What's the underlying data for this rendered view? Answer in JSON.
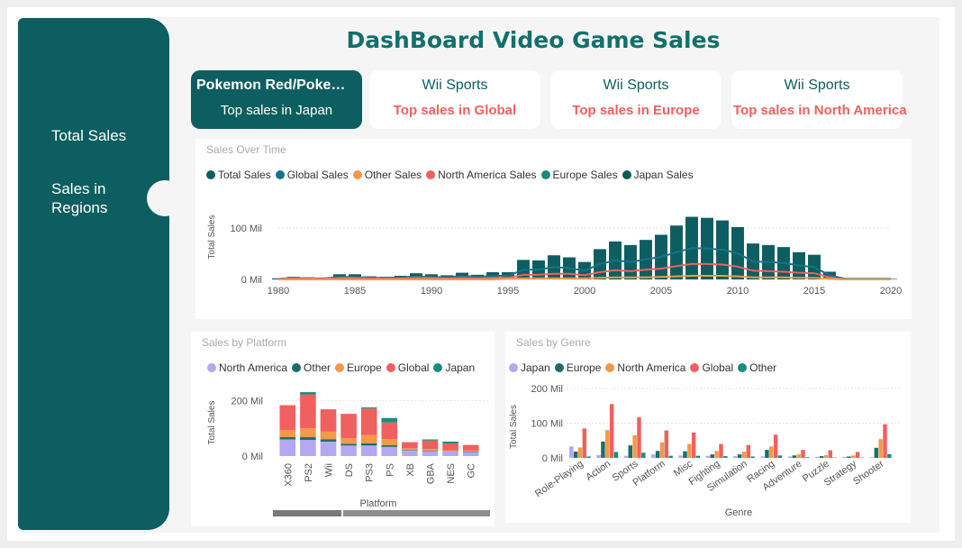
{
  "header": {
    "title": "DashBoard Video Game Sales"
  },
  "sidebar": {
    "items": [
      {
        "label": "Total Sales"
      },
      {
        "label": "Sales in Regions"
      }
    ]
  },
  "cards": [
    {
      "game": "Pokemon Red/Pokemon Blue",
      "caption": "Top sales in Japan",
      "active": true
    },
    {
      "game": "Wii Sports",
      "caption": "Top sales in Global",
      "active": false
    },
    {
      "game": "Wii Sports",
      "caption": "Top sales in Europe",
      "active": false
    },
    {
      "game": "Wii Sports",
      "caption": "Top sales in North America",
      "active": false
    }
  ],
  "colors": {
    "teal_dark": "#0d5e60",
    "teal": "#118dff",
    "other": "#f2994a",
    "north_america": "#f0605e",
    "europe": "#1a8c7e",
    "japan": "#0b5c50",
    "lavender": "#b3a8f2"
  },
  "chart_data": [
    {
      "type": "bar",
      "title": "Sales Over Time",
      "xlabel": "",
      "ylabel": "Total Sales",
      "yticks": [
        "0 Mil",
        "100 Mil"
      ],
      "xticks": [
        "1980",
        "1985",
        "1990",
        "1995",
        "2000",
        "2005",
        "2010",
        "2015",
        "2020"
      ],
      "xlim": [
        1980,
        2020
      ],
      "ylim": [
        0,
        130
      ],
      "legend": [
        "Total Sales",
        "Global Sales",
        "Other Sales",
        "North America  Sales",
        "Europe Sales",
        "Japan Sales"
      ],
      "legend_colors": [
        "#0d5e60",
        "#13748a",
        "#f2994a",
        "#f0605e",
        "#1a8c7e",
        "#0b5c50"
      ],
      "x": [
        1980,
        1981,
        1982,
        1983,
        1984,
        1985,
        1986,
        1987,
        1988,
        1989,
        1990,
        1991,
        1992,
        1993,
        1994,
        1995,
        1996,
        1997,
        1998,
        1999,
        2000,
        2001,
        2002,
        2003,
        2004,
        2005,
        2006,
        2007,
        2008,
        2009,
        2010,
        2011,
        2012,
        2013,
        2014,
        2015,
        2016,
        2017,
        2020
      ],
      "values": [
        2,
        5,
        4,
        3,
        10,
        10,
        6,
        5,
        7,
        12,
        10,
        8,
        13,
        9,
        14,
        14,
        38,
        37,
        47,
        43,
        34,
        59,
        74,
        67,
        77,
        87,
        105,
        122,
        120,
        115,
        102,
        70,
        67,
        63,
        53,
        48,
        15,
        1,
        1
      ],
      "lines": [
        {
          "name": "Global Sales",
          "color": "#13748a",
          "values": [
            1,
            3,
            2,
            2,
            5,
            5,
            3,
            3,
            4,
            6,
            5,
            4,
            7,
            5,
            7,
            7,
            19,
            19,
            24,
            22,
            17,
            30,
            37,
            34,
            39,
            44,
            53,
            61,
            60,
            58,
            51,
            35,
            34,
            32,
            27,
            24,
            8,
            1,
            1
          ]
        },
        {
          "name": "North America  Sales",
          "color": "#f0605e",
          "values": [
            1,
            2,
            2,
            1,
            3,
            3,
            2,
            2,
            2,
            3,
            3,
            2,
            3,
            2,
            3,
            3,
            9,
            9,
            11,
            11,
            8,
            14,
            18,
            16,
            19,
            21,
            26,
            30,
            30,
            29,
            25,
            17,
            16,
            15,
            13,
            12,
            4,
            0,
            0
          ]
        },
        {
          "name": "Other Sales",
          "color": "#f2994a",
          "values": [
            0,
            0,
            0,
            0,
            0,
            0,
            0,
            0,
            0,
            0,
            0,
            0,
            0,
            0,
            0,
            1,
            2,
            2,
            2,
            2,
            2,
            3,
            4,
            4,
            4,
            5,
            6,
            7,
            7,
            7,
            6,
            4,
            4,
            4,
            3,
            3,
            1,
            0,
            0
          ]
        }
      ]
    },
    {
      "type": "bar",
      "stacked": true,
      "title": "Sales by Platform",
      "xlabel": "Platform",
      "ylabel": "Total Sales",
      "yticks": [
        "0 Mil",
        "200 Mil"
      ],
      "ylim": [
        0,
        240
      ],
      "legend": [
        "North America",
        "Other",
        "Europe",
        "Global",
        "Japan"
      ],
      "legend_colors": [
        "#b3a8f2",
        "#1a6e6a",
        "#f2994a",
        "#f0605e",
        "#1a8c7e"
      ],
      "categories": [
        "X360",
        "PS2",
        "Wii",
        "DS",
        "PS3",
        "PS",
        "XB",
        "GBA",
        "NES",
        "GC"
      ],
      "series": [
        {
          "name": "North America",
          "values": [
            60,
            58,
            52,
            38,
            38,
            33,
            20,
            18,
            16,
            14
          ]
        },
        {
          "name": "Other",
          "values": [
            8,
            10,
            8,
            6,
            8,
            6,
            2,
            2,
            1,
            2
          ]
        },
        {
          "name": "Europe",
          "values": [
            25,
            32,
            28,
            20,
            30,
            22,
            6,
            6,
            4,
            4
          ]
        },
        {
          "name": "Global",
          "values": [
            90,
            122,
            78,
            88,
            95,
            60,
            22,
            30,
            24,
            20
          ]
        },
        {
          "name": "Japan",
          "values": [
            0,
            8,
            2,
            0,
            4,
            16,
            0,
            4,
            7,
            0
          ]
        }
      ]
    },
    {
      "type": "bar",
      "title": "Sales by Genre",
      "xlabel": "Genre",
      "ylabel": "Total Sales",
      "yticks": [
        "0 Mil",
        "100 Mil",
        "200 Mil"
      ],
      "ylim": [
        0,
        200
      ],
      "legend": [
        "Japan",
        "Europe",
        "North America",
        "Global",
        "Other"
      ],
      "legend_colors": [
        "#b3a8f2",
        "#1a6e6a",
        "#f2994a",
        "#f0605e",
        "#1a8c7e"
      ],
      "categories": [
        "Role-Playing",
        "Action",
        "Sports",
        "Platform",
        "Misc",
        "Fighting",
        "Simulation",
        "Racing",
        "Adventure",
        "Puzzle",
        "Strategy",
        "Shooter"
      ],
      "series": [
        {
          "name": "Japan",
          "values": [
            33,
            8,
            6,
            10,
            7,
            6,
            5,
            4,
            4,
            3,
            3,
            2
          ]
        },
        {
          "name": "Europe",
          "values": [
            18,
            47,
            36,
            20,
            19,
            10,
            10,
            23,
            7,
            5,
            4,
            29
          ]
        },
        {
          "name": "North America",
          "values": [
            30,
            80,
            65,
            45,
            40,
            20,
            18,
            33,
            10,
            8,
            7,
            54
          ]
        },
        {
          "name": "Global",
          "values": [
            85,
            155,
            117,
            79,
            73,
            40,
            37,
            67,
            23,
            22,
            17,
            97
          ]
        },
        {
          "name": "Other",
          "values": [
            4,
            17,
            15,
            6,
            6,
            5,
            4,
            7,
            2,
            1,
            1,
            11
          ]
        }
      ]
    }
  ]
}
